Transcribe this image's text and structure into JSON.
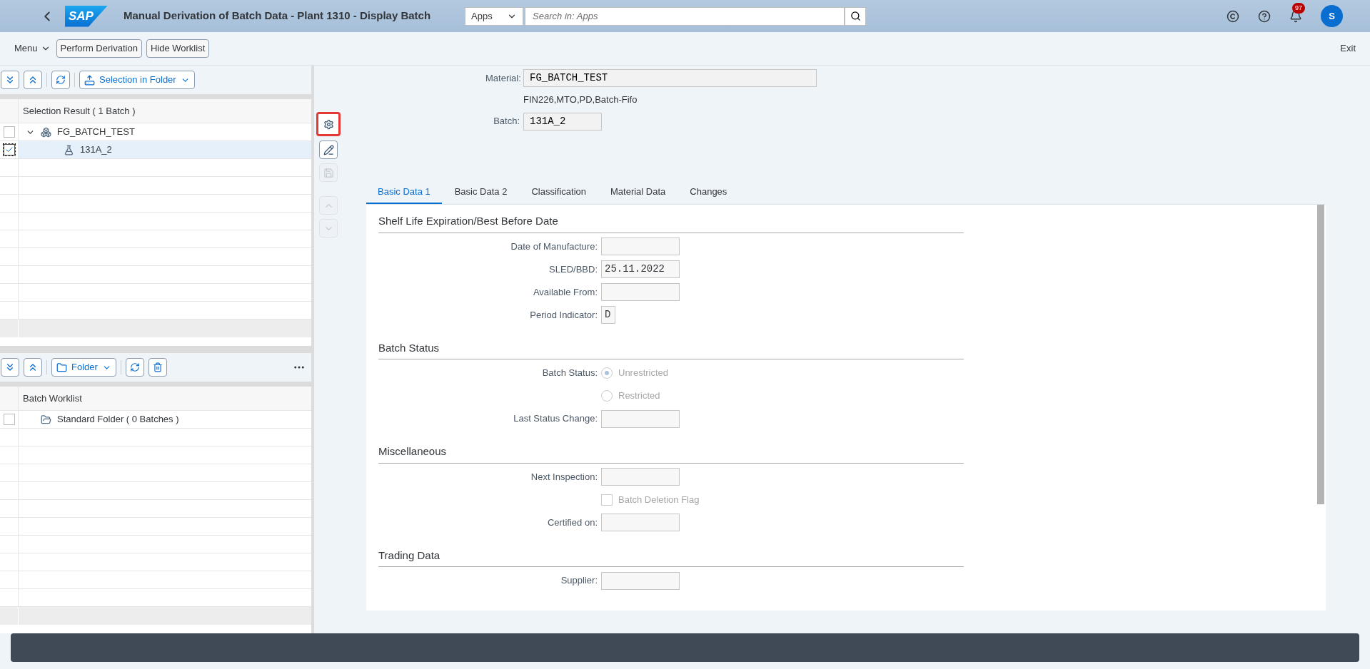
{
  "shell": {
    "logo": "SAP",
    "title": "Manual Derivation of Batch Data - Plant 1310 - Display Batch",
    "search": {
      "scope": "Apps",
      "placeholder": "Search in: Apps"
    },
    "notification_count": "97",
    "avatar_initial": "S"
  },
  "toolbar": {
    "menu": "Menu",
    "buttons": [
      "Perform Derivation",
      "Hide Worklist"
    ],
    "exit": "Exit"
  },
  "selection_panel": {
    "folder_button": "Selection in Folder",
    "header": "Selection Result ( 1 Batch )",
    "tree": [
      {
        "label": "FG_BATCH_TEST",
        "kind": "material",
        "checked": false,
        "selected": false,
        "expanded": true,
        "children": [
          {
            "label": "131A_2",
            "kind": "batch",
            "checked": true,
            "selected": true
          }
        ]
      }
    ]
  },
  "worklist_panel": {
    "folder_button": "Folder",
    "header": "Batch Worklist",
    "tree": [
      {
        "label": "Standard Folder ( 0 Batches )",
        "kind": "folder",
        "checked": false,
        "selected": false
      }
    ]
  },
  "side_tools": [
    {
      "kind": "derive",
      "highlighted": true,
      "disabled": false
    },
    {
      "kind": "edit",
      "highlighted": false,
      "disabled": false
    },
    {
      "kind": "save",
      "highlighted": false,
      "disabled": true
    },
    {
      "kind": "up",
      "highlighted": false,
      "disabled": true
    },
    {
      "kind": "down",
      "highlighted": false,
      "disabled": true
    }
  ],
  "header": {
    "material": {
      "label": "Material:",
      "value": "FG_BATCH_TEST"
    },
    "description": "FIN226,MTO,PD,Batch-Fifo",
    "batch": {
      "label": "Batch:",
      "value": "131A_2"
    }
  },
  "tabs": [
    {
      "label": "Basic Data 1",
      "selected": true
    },
    {
      "label": "Basic Data 2",
      "selected": false
    },
    {
      "label": "Classification",
      "selected": false
    },
    {
      "label": "Material Data",
      "selected": false
    },
    {
      "label": "Changes",
      "selected": false
    }
  ],
  "sections": [
    {
      "title": "Shelf Life Expiration/Best Before Date",
      "fields": [
        {
          "kind": "field",
          "label": "Date of Manufacture:"
        },
        {
          "kind": "field",
          "label": "SLED/BBD:",
          "value": "25.11.2022"
        },
        {
          "kind": "field",
          "label": "Available From:"
        },
        {
          "kind": "short_field",
          "label": "Period Indicator:",
          "value": "D"
        }
      ]
    },
    {
      "title": "Batch Status",
      "fields": [
        {
          "kind": "radio",
          "label": "Batch Status:",
          "option": "Unrestricted",
          "selected": true,
          "disabled": true
        },
        {
          "kind": "radio",
          "option": "Restricted",
          "selected": false,
          "disabled": true
        },
        {
          "kind": "field",
          "label": "Last Status Change:"
        }
      ]
    },
    {
      "title": "Miscellaneous",
      "fields": [
        {
          "kind": "field",
          "label": "Next Inspection:"
        },
        {
          "kind": "checkbox",
          "option": "Batch Deletion Flag",
          "checked": false,
          "disabled": true
        },
        {
          "kind": "field",
          "label": "Certified on:"
        }
      ]
    },
    {
      "title": "Trading Data",
      "fields": [
        {
          "kind": "field",
          "label": "Supplier:"
        }
      ]
    }
  ]
}
